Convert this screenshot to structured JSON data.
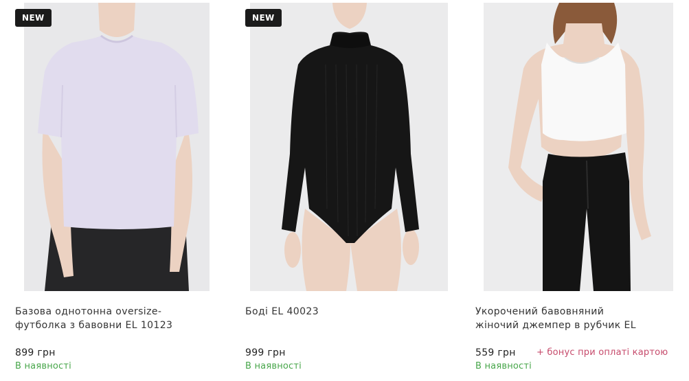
{
  "products": [
    {
      "badge": "NEW",
      "title_line1": "Базова однотонна oversize-",
      "title_line2": "футболка з бавовни EL 10123",
      "price": "899 грн",
      "availability": "В наявності",
      "image_label": "lilac-oversize-tshirt-photo"
    },
    {
      "badge": "NEW",
      "title_line1": "Боді EL 40023",
      "title_line2": "",
      "price": "999 грн",
      "availability": "В наявності",
      "image_label": "black-ribbed-bodysuit-photo"
    },
    {
      "badge": "",
      "title_line1": "Укорочений бавовняний",
      "title_line2": "жіночий джемпер в рубчик EL",
      "price": "559 грн",
      "bonus": "+ бонус при оплаті картою",
      "availability": "В наявності",
      "image_label": "white-ribbed-crop-top-photo"
    }
  ],
  "colors": {
    "badge_bg": "#1b1b1b",
    "availability": "#47a64a",
    "bonus": "#c64a6b",
    "photo_bg": "#e9e9ea"
  }
}
